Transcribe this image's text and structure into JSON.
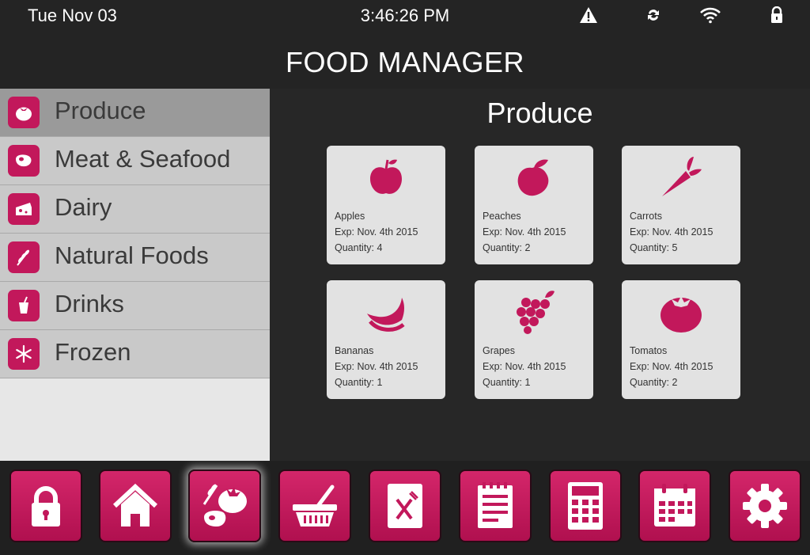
{
  "status_bar": {
    "date": "Tue Nov 03",
    "time": "3:46:26 PM",
    "icons": [
      "warning-icon",
      "sync-icon",
      "wifi-icon",
      "lock-icon"
    ]
  },
  "app_title": "FOOD MANAGER",
  "colors": {
    "accent": "#c2185b",
    "sidebar_active": "#9a9a9a",
    "sidebar_item": "#c9c9c9",
    "card": "#e2e2e2"
  },
  "sidebar": {
    "items": [
      {
        "label": "Produce",
        "icon": "tomato-icon",
        "active": true
      },
      {
        "label": "Meat & Seafood",
        "icon": "steak-icon",
        "active": false
      },
      {
        "label": "Dairy",
        "icon": "cheese-icon",
        "active": false
      },
      {
        "label": "Natural Foods",
        "icon": "wheat-icon",
        "active": false
      },
      {
        "label": "Drinks",
        "icon": "cup-icon",
        "active": false
      },
      {
        "label": "Frozen",
        "icon": "snowflake-icon",
        "active": false
      }
    ]
  },
  "main": {
    "title": "Produce",
    "items": [
      {
        "name": "Apples",
        "exp": "Exp: Nov. 4th 2015",
        "quantity": "Quantity: 4",
        "icon": "apple-icon"
      },
      {
        "name": "Peaches",
        "exp": "Exp: Nov. 4th 2015",
        "quantity": "Quantity: 2",
        "icon": "peach-icon"
      },
      {
        "name": "Carrots",
        "exp": "Exp: Nov. 4th 2015",
        "quantity": "Quantity: 5",
        "icon": "carrot-icon"
      },
      {
        "name": "Bananas",
        "exp": "Exp: Nov. 4th 2015",
        "quantity": "Quantity: 1",
        "icon": "banana-icon"
      },
      {
        "name": "Grapes",
        "exp": "Exp: Nov. 4th 2015",
        "quantity": "Quantity: 1",
        "icon": "grapes-icon"
      },
      {
        "name": "Tomatos",
        "exp": "Exp: Nov. 4th 2015",
        "quantity": "Quantity: 2",
        "icon": "tomato-icon"
      }
    ]
  },
  "dock": {
    "buttons": [
      {
        "icon": "padlock-icon",
        "active": false
      },
      {
        "icon": "home-icon",
        "active": false
      },
      {
        "icon": "food-icon",
        "active": true
      },
      {
        "icon": "basket-icon",
        "active": false
      },
      {
        "icon": "recipe-book-icon",
        "active": false
      },
      {
        "icon": "notepad-icon",
        "active": false
      },
      {
        "icon": "calculator-icon",
        "active": false
      },
      {
        "icon": "calendar-icon",
        "active": false
      },
      {
        "icon": "settings-gear-icon",
        "active": false
      }
    ]
  }
}
